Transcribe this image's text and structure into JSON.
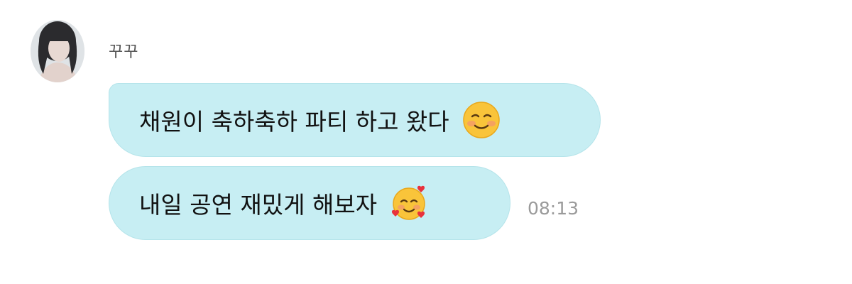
{
  "chat": {
    "sender_name": "꾸꾸",
    "messages": [
      {
        "text": "채원이 축하축하 파티 하고 왔다",
        "emoji": "smiling-face-icon"
      },
      {
        "text": "내일 공연 재밌게 해보자",
        "emoji": "smiling-face-with-hearts-icon"
      }
    ],
    "timestamp": "08:13"
  },
  "colors": {
    "bubble_background": "#c7eef3",
    "text": "#111111",
    "timestamp": "#9a9a9a"
  }
}
